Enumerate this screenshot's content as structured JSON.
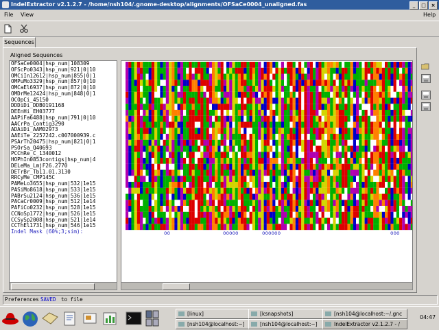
{
  "window": {
    "title": "IndelExtractor v2.1.2.7 - /home/nsh104/.gnome-desktop/alignments/OFSaCe0004_unaligned.fas",
    "buttons": [
      "_",
      "□",
      "×"
    ]
  },
  "menu": {
    "file": "File",
    "view": "View",
    "help": "Help"
  },
  "tabs": {
    "sequences": "Sequences"
  },
  "panel": {
    "title": "Aligned Sequences"
  },
  "sequences": [
    "OFSaCe0004|hsp_num|108309",
    "OFScPo0343|hsp_num|921|0|10",
    "OMCiIn12612|hsp_num|855|0|1",
    "OMPuMo3329|hsp_num|857|0|10",
    "OMCaEl6937|hsp_num|872|0|10",
    "OMDrMe12424|hsp_num|848|0|1",
    "OCOpCi_45150",
    "DDDiDi_DDB0191168",
    "DEEnHi_EH03777",
    "AAPiFa6488|hsp_num|791|0|10",
    "AACrPa_Contig3290",
    "ADAiDi_AAM02973",
    "AAEiTe_2257242.c007000939.c",
    "PSArTh20475|hsp_num|821|0|1",
    "PSOrSa_Q40693",
    "PCChRe_C_1340012",
    "HOPhIn0853contigs|hsp_num|4",
    "DELeMa_LmjF26.2770",
    "DETrBr_Tb11.01.3130",
    "RRCyMe_CMP145C",
    "PAMeLo3655|hsp_num|532|1e15",
    "PASiMo8618|hsp_num|533|1e15",
    "PABrSu2124|hsp_num|536|1e15",
    "PACaCr0009|hsp_num|512|1e14",
    "PAFiCo0232|hsp_num|528|1e15",
    "CCNoSp1772|hsp_num|526|1e15",
    "CCSySp2008|hsp_num|521|1e14",
    "CCThEl1731|hsp_num|546|1e15"
  ],
  "mask_label": "Indel Mask (60%;3;sim):",
  "mask_marks": [
    "oo",
    "ooooo",
    "oooooo",
    "ooo"
  ],
  "status": {
    "prefix": "Preferences",
    "highlight": "SAVED",
    "suffix": "to file"
  },
  "status_colors": {
    "highlight": "#0000cc"
  },
  "taskbar": {
    "tasks": [
      "[linux]",
      "[ksnapshots]",
      "[nsh104@localhost:~/.gnc",
      "[nsh104@localhost:~]",
      "[nsh104@localhost:~]",
      "IndelExtractor v2.1.2.7 - /"
    ],
    "clock": "04:47"
  },
  "icons": {
    "new": "new-document-icon",
    "cut": "scissors-icon",
    "folder": "open-folder-icon",
    "save": "save-icon",
    "save_as": "save-as-icon",
    "export": "export-icon"
  },
  "colors": {
    "titlebar": "#2f5d9e",
    "hydrophobic": "#00b000",
    "polar": "#d4d400",
    "negative": "#dd0000",
    "positive": "#b000b0",
    "aromatic": "#0000c8",
    "glycine": "#ff8000",
    "gap": "#ffffff"
  }
}
